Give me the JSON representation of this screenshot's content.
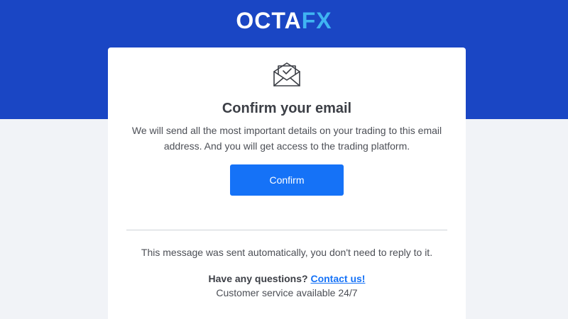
{
  "header": {
    "logo_main": "OCTA",
    "logo_accent": "FX",
    "brand_color": "#1a46c4",
    "accent_color": "#3fb4f2"
  },
  "card": {
    "icon": "envelope-check-icon",
    "title": "Confirm your email",
    "description": "We will send all the most important details on your trading to this email address. And you will get access to the trading platform.",
    "confirm_label": "Confirm",
    "button_color": "#1572f7"
  },
  "footer": {
    "auto_note": "This message was sent automatically, you don't need to reply to it.",
    "questions_text": "Have any questions?",
    "contact_link": "Contact us!",
    "service_note": "Customer service available 24/7"
  }
}
